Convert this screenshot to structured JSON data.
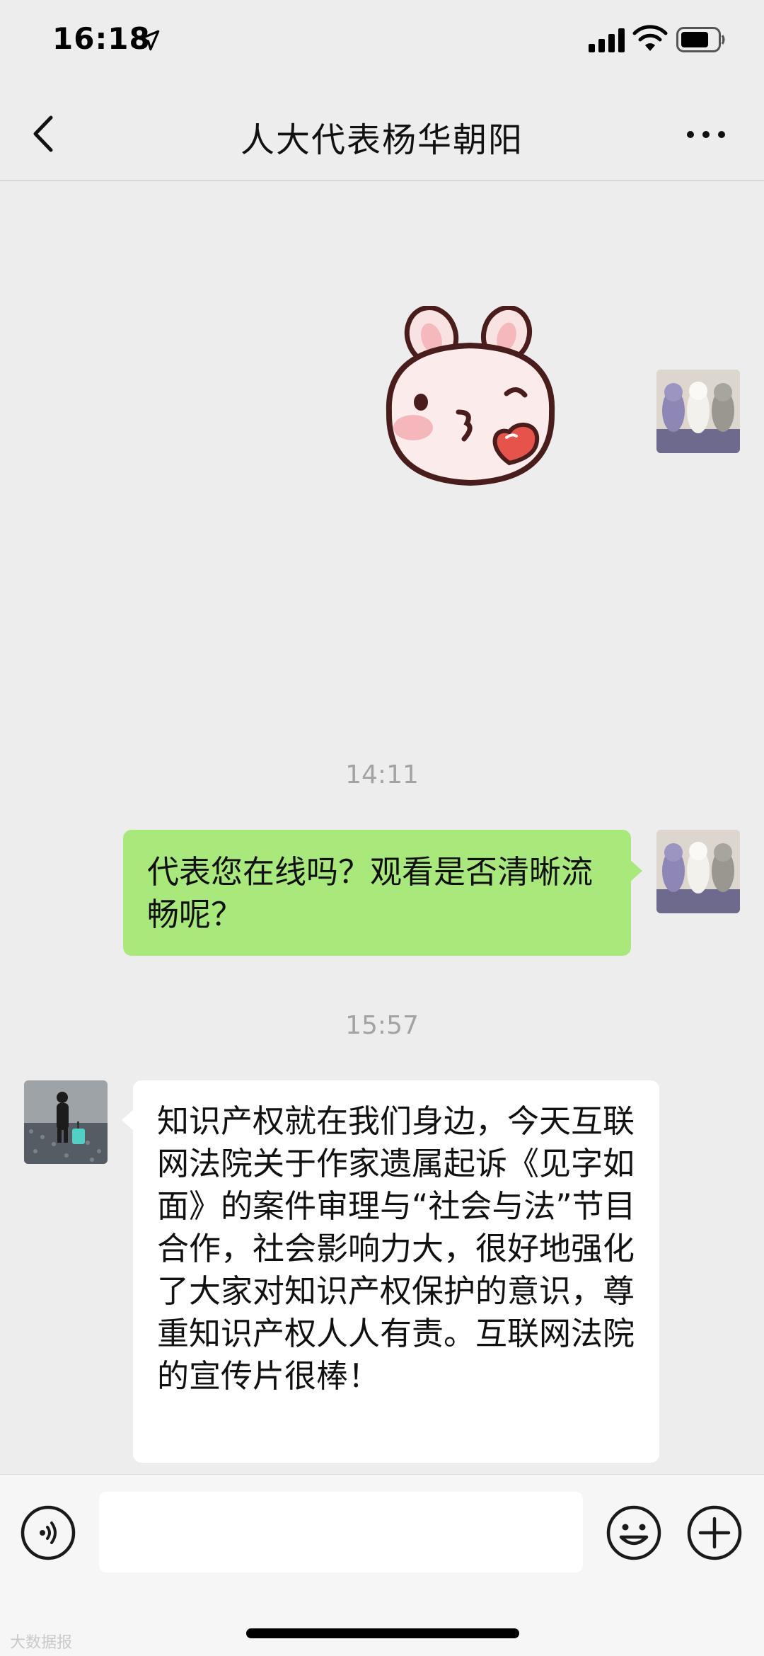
{
  "status_bar": {
    "time": "16:18",
    "location_icon": "location-arrow-icon",
    "signal_icon": "cellular-signal-icon",
    "wifi_icon": "wifi-icon",
    "battery_icon": "battery-icon"
  },
  "nav": {
    "title": "人大代表杨华朝阳",
    "back_icon": "chevron-left-icon",
    "more_icon": "more-dots-icon"
  },
  "chat": {
    "messages": [
      {
        "type": "sticker",
        "direction": "outgoing",
        "sticker_name": "pink-bunny-kiss-heart"
      },
      {
        "type": "time",
        "text": "14:11"
      },
      {
        "type": "text",
        "direction": "outgoing",
        "text": "代表您在线吗？观看是否清晰流畅呢？"
      },
      {
        "type": "time",
        "text": "15:57"
      },
      {
        "type": "text",
        "direction": "incoming",
        "text": "知识产权就在我们身边，今天互联网法院关于作家遗属起诉《见字如面》的案件审理与“社会与法”节目合作，社会影响力大，很好地强化了大家对知识产权保护的意识，尊重知识产权人人有责。互联网法院的宣传片很棒！"
      }
    ]
  },
  "input_bar": {
    "value": "",
    "voice_icon": "voice-icon",
    "emoji_icon": "emoji-smile-icon",
    "plus_icon": "plus-icon"
  },
  "watermark": "大数据报",
  "colors": {
    "background": "#ededed",
    "outgoing_bubble": "#a9e87a",
    "incoming_bubble": "#ffffff",
    "timestamp_text": "#a3a3a3"
  }
}
